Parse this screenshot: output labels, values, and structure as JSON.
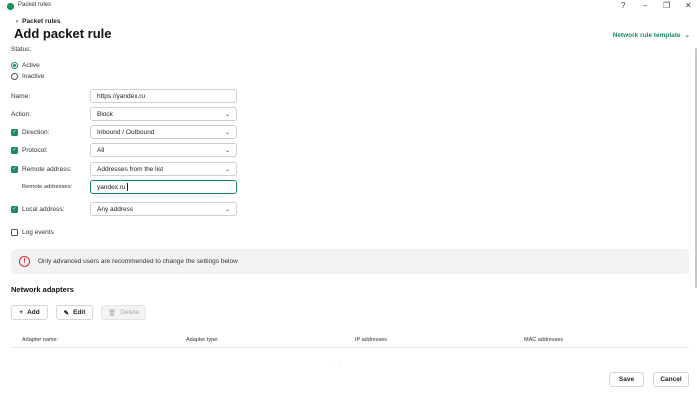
{
  "window": {
    "title": "Packet rules",
    "controls": {
      "help": "?",
      "minimize": "–",
      "restore": "❐",
      "close": "✕"
    }
  },
  "header": {
    "back_label": "Packet rules",
    "title": "Add packet rule",
    "template_link": "Network rule template"
  },
  "status": {
    "label": "Status:",
    "options": [
      {
        "label": "Active",
        "checked": true
      },
      {
        "label": "Inactive",
        "checked": false
      }
    ]
  },
  "form": {
    "name": {
      "label": "Name:",
      "value": "https://yandex.ru"
    },
    "action": {
      "label": "Action:",
      "value": "Block"
    },
    "direction": {
      "label": "Direction:",
      "value": "Inbound / Outbound",
      "checked": true
    },
    "protocol": {
      "label": "Protocol:",
      "value": "All",
      "checked": true
    },
    "remote_address": {
      "label": "Remote address:",
      "value": "Addresses from the list",
      "checked": true
    },
    "remote_addresses": {
      "label": "Remote addresses:",
      "value": "yandex.ru"
    },
    "local_address": {
      "label": "Local address:",
      "value": "Any address",
      "checked": true
    },
    "log_events": {
      "label": "Log events",
      "checked": false
    }
  },
  "warning": {
    "text": "Only advanced users are recommended to change the settings below"
  },
  "adapters": {
    "title": "Network adapters",
    "add_label": "Add",
    "edit_label": "Edit",
    "delete_label": "Delete",
    "columns": [
      "Adapter name:",
      "Adapter type:",
      "IP addresses",
      "MAC addresses"
    ]
  },
  "footer": {
    "save_label": "Save",
    "cancel_label": "Cancel"
  },
  "colors": {
    "accent": "#1a8a6b",
    "warning": "#d93434"
  }
}
